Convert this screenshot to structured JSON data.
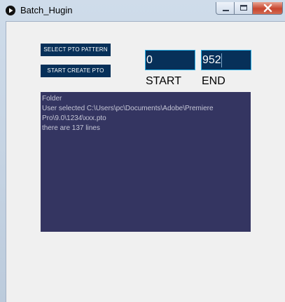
{
  "window": {
    "title": "Batch_Hugin",
    "controls": {
      "minimize": "minimize-icon",
      "maximize": "maximize-icon",
      "close": "close-icon"
    }
  },
  "buttons": {
    "select_pto_pattern": "SELECT PTO PATTERN",
    "start_create_pto": "START CREATE PTO"
  },
  "range": {
    "start_value": "0",
    "end_value": "952",
    "start_label": "START",
    "end_label": "END"
  },
  "log": {
    "lines": [
      "Folder",
      "User selected C:\\Users\\pc\\Documents\\Adobe\\Premiere Pro\\9.0\\1234\\xxx.pto",
      "there are 137 lines"
    ]
  },
  "colors": {
    "button_bg": "#073059",
    "field_border": "#2bb0e6",
    "log_bg": "#343561",
    "close_button": "#c7452e"
  }
}
